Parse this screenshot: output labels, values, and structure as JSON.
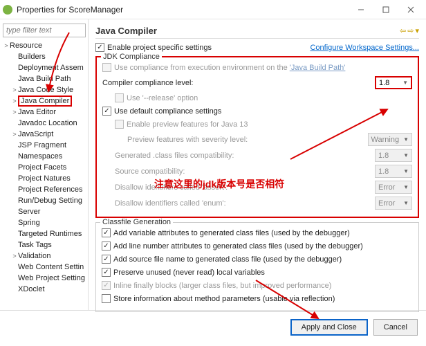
{
  "window": {
    "title": "Properties for ScoreManager"
  },
  "sidebar": {
    "filter_placeholder": "type filter text",
    "items": [
      {
        "label": "Resource",
        "level": 1,
        "exp": ">"
      },
      {
        "label": "Builders",
        "level": 2,
        "exp": ""
      },
      {
        "label": "Deployment Assem",
        "level": 2,
        "exp": ""
      },
      {
        "label": "Java Build Path",
        "level": 2,
        "exp": ""
      },
      {
        "label": "Java Code Style",
        "level": 2,
        "exp": ">"
      },
      {
        "label": "Java Compiler",
        "level": 2,
        "exp": ">",
        "sel": true
      },
      {
        "label": "Java Editor",
        "level": 2,
        "exp": ">"
      },
      {
        "label": "Javadoc Location",
        "level": 2,
        "exp": ""
      },
      {
        "label": "JavaScript",
        "level": 2,
        "exp": ">"
      },
      {
        "label": "JSP Fragment",
        "level": 2,
        "exp": ""
      },
      {
        "label": "Namespaces",
        "level": 2,
        "exp": ""
      },
      {
        "label": "Project Facets",
        "level": 2,
        "exp": ""
      },
      {
        "label": "Project Natures",
        "level": 2,
        "exp": ""
      },
      {
        "label": "Project References",
        "level": 2,
        "exp": ""
      },
      {
        "label": "Run/Debug Setting",
        "level": 2,
        "exp": ""
      },
      {
        "label": "Server",
        "level": 2,
        "exp": ""
      },
      {
        "label": "Spring",
        "level": 2,
        "exp": ""
      },
      {
        "label": "Targeted Runtimes",
        "level": 2,
        "exp": ""
      },
      {
        "label": "Task Tags",
        "level": 2,
        "exp": ""
      },
      {
        "label": "Validation",
        "level": 2,
        "exp": ">"
      },
      {
        "label": "Web Content Settin",
        "level": 2,
        "exp": ""
      },
      {
        "label": "Web Project Setting",
        "level": 2,
        "exp": ""
      },
      {
        "label": "XDoclet",
        "level": 2,
        "exp": ""
      }
    ]
  },
  "main": {
    "title": "Java Compiler",
    "enable_label": "Enable project specific settings",
    "configure_link": "Configure Workspace Settings...",
    "jdk": {
      "legend": "JDK Compliance",
      "use_exec_env_pre": "Use compliance from execution environment on the ",
      "use_exec_env_link": "'Java Build Path'",
      "compiler_level_label": "Compiler compliance level:",
      "compiler_level_value": "1.8",
      "use_release": "Use '--release' option",
      "use_default": "Use default compliance settings",
      "preview_label": "Enable preview features for Java 13",
      "preview_sev_label": "Preview features with severity level:",
      "preview_sev_value": "Warning",
      "gen_compat_label": "Generated .class files compatibility:",
      "gen_compat_value": "1.8",
      "src_compat_label": "Source compatibility:",
      "src_compat_value": "1.8",
      "assert_label": "Disallow identifiers called 'assert':",
      "assert_value": "Error",
      "enum_label": "Disallow identifiers called 'enum':",
      "enum_value": "Error"
    },
    "classfile": {
      "legend": "Classfile Generation",
      "c1": "Add variable attributes to generated class files (used by the debugger)",
      "c2": "Add line number attributes to generated class files (used by the debugger)",
      "c3": "Add source file name to generated class file (used by the debugger)",
      "c4": "Preserve unused (never read) local variables",
      "c5": "Inline finally blocks (larger class files, but improved performance)",
      "c6": "Store information about method parameters (usable via reflection)"
    }
  },
  "footer": {
    "apply": "Apply and Close",
    "cancel": "Cancel"
  },
  "annotation": {
    "text": "注意这里的jdk版本号是否相符"
  }
}
